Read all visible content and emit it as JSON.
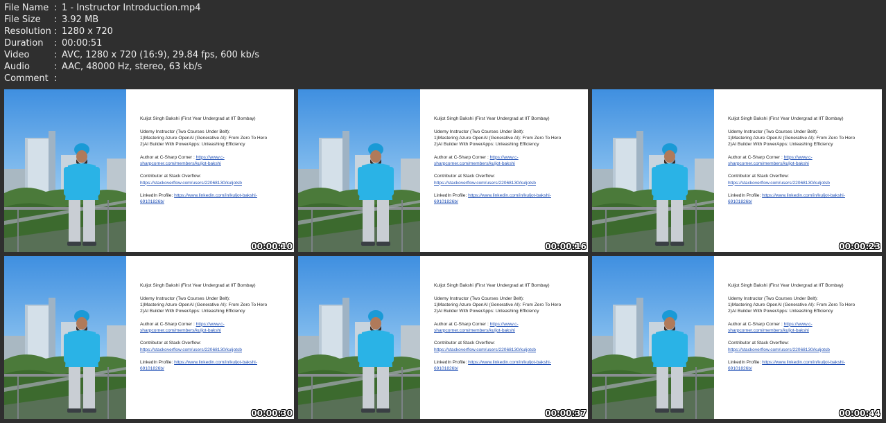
{
  "meta": [
    {
      "key": "File Name",
      "sep": ":",
      "value": "1 - Instructor Introduction.mp4"
    },
    {
      "key": "File Size",
      "sep": ":",
      "value": "3.92 MB"
    },
    {
      "key": "Resolution",
      "sep": ":",
      "value": "1280 x 720"
    },
    {
      "key": "Duration",
      "sep": ":",
      "value": "00:00:51"
    },
    {
      "key": "Video",
      "sep": ":",
      "value": "AVC, 1280 x 720 (16:9), 29.84 fps, 600 kb/s"
    },
    {
      "key": "Audio",
      "sep": ":",
      "value": "AAC, 48000 Hz, stereo, 63 kb/s"
    },
    {
      "key": "Comment",
      "sep": ":",
      "value": ""
    }
  ],
  "slide": {
    "title": "Kuljot Singh Bakshi (First Year Undergrad at IIT Bombay)",
    "udemy_heading": "Udemy Instructor (Two Courses Under Belt):",
    "course1": "1)Mastering Azure OpenAI (Generative AI): From Zero To Hero",
    "course2": "2)AI Builder With PowerApps: Unleashing Efficiency",
    "author_label": "Author at C-Sharp Corner : ",
    "author_link_1": "https://www.c-",
    "author_link_2": "sharpcorner.com/members/kuljot-bakshi",
    "so_label": "Contributor at Stack Overflow:",
    "so_link": "https://stackoverflow.com/users/22068130/kuljotsb",
    "li_label": "LinkedIn Profile: ",
    "li_link_1": "https://www.linkedin.com/in/kuljot-bakshi-",
    "li_link_2": "69101826b/"
  },
  "thumbs": [
    {
      "time": "00:00:10"
    },
    {
      "time": "00:00:16"
    },
    {
      "time": "00:00:23"
    },
    {
      "time": "00:00:30"
    },
    {
      "time": "00:00:37"
    },
    {
      "time": "00:00:44"
    }
  ],
  "colors": {
    "background": "#2f2f2f",
    "text": "#ececec",
    "link": "#1f4fb5",
    "sky": "#5aa6ec",
    "shirt": "#2ab3e6"
  }
}
